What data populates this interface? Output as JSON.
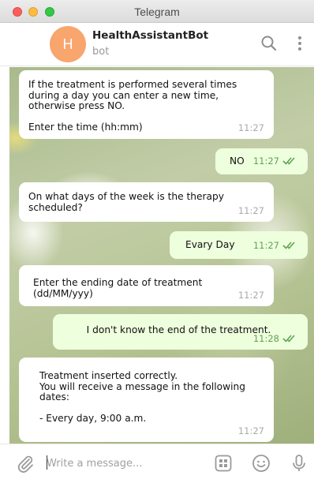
{
  "window": {
    "title": "Telegram"
  },
  "header": {
    "avatar_letter": "H",
    "name": "HealthAssistantBot",
    "status": "bot"
  },
  "messages": [
    {
      "dir": "in",
      "text": "If the treatment is performed several times\nduring a day you can enter a new time,\notherwise press NO.\n\nEnter the time (hh:mm)",
      "time": "11:27"
    },
    {
      "dir": "out",
      "text": "NO",
      "time": "11:27"
    },
    {
      "dir": "in",
      "text": "On what days of the week is the therapy\nscheduled?",
      "time": "11:27"
    },
    {
      "dir": "out",
      "text": "Evary Day",
      "time": "11:27"
    },
    {
      "dir": "in",
      "text": "Enter the ending date of treatment (dd/MM/yyy)",
      "time": "11:27"
    },
    {
      "dir": "out",
      "text": "I don't know the end of the treatment.",
      "time": "11:28"
    },
    {
      "dir": "in",
      "text": "Treatment inserted correctly.\nYou will receive a message in the following\ndates:\n\n- Every day, 9:00 a.m.",
      "time": "11:27"
    }
  ],
  "composer": {
    "placeholder": "Write a message..."
  },
  "colors": {
    "avatar": "#f8a56e",
    "outgoing_bubble": "#eeffde",
    "check": "#5fa352"
  }
}
